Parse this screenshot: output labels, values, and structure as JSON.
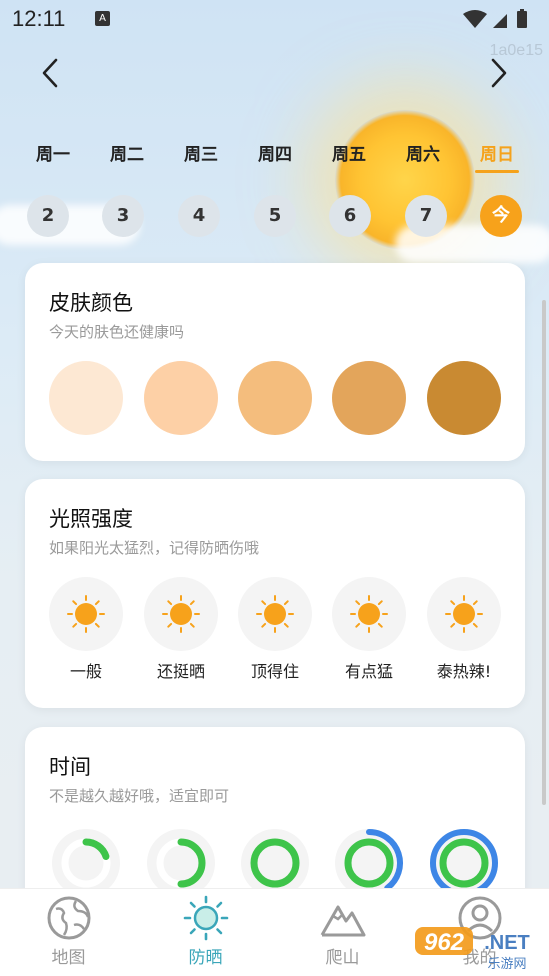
{
  "status_bar": {
    "time": "12:11",
    "app_badge": "A",
    "watermark": "1a0e15"
  },
  "nav": {
    "prev_icon": "chevron-left-icon",
    "next_icon": "chevron-right-icon"
  },
  "week": {
    "days": [
      {
        "label": "周一",
        "date": "2"
      },
      {
        "label": "周二",
        "date": "3"
      },
      {
        "label": "周三",
        "date": "4"
      },
      {
        "label": "周四",
        "date": "5"
      },
      {
        "label": "周五",
        "date": "6"
      },
      {
        "label": "周六",
        "date": "7"
      },
      {
        "label": "周日",
        "date": "今"
      }
    ],
    "active_index": 6,
    "accent_color": "#f5a21b"
  },
  "skin_card": {
    "title": "皮肤颜色",
    "subtitle": "今天的肤色还健康吗",
    "swatches": [
      "#fde8d3",
      "#fdd0a6",
      "#f4bd7d",
      "#e3a55b",
      "#c98a32"
    ]
  },
  "light_card": {
    "title": "光照强度",
    "subtitle": "如果阳光太猛烈，记得防晒伤哦",
    "levels": [
      {
        "label": "一般",
        "icon": "sun-icon"
      },
      {
        "label": "还挺晒",
        "icon": "sun-icon"
      },
      {
        "label": "顶得住",
        "icon": "sun-icon"
      },
      {
        "label": "有点猛",
        "icon": "sun-icon"
      },
      {
        "label": "泰热辣!",
        "icon": "sun-icon"
      }
    ],
    "sun_color": "#f7a21b"
  },
  "time_card": {
    "title": "时间",
    "subtitle": "不是越久越好哦，适宜即可",
    "levels": [
      {
        "green_fraction": 0.2,
        "blue_fraction": 0
      },
      {
        "green_fraction": 0.5,
        "blue_fraction": 0
      },
      {
        "green_fraction": 1.0,
        "blue_fraction": 0
      },
      {
        "green_fraction": 1.0,
        "blue_fraction": 0.4
      },
      {
        "green_fraction": 1.0,
        "blue_fraction": 1.0
      }
    ],
    "green": "#3ec44a",
    "blue": "#3d86e6"
  },
  "tabbar": {
    "tabs": [
      {
        "label": "地图",
        "icon": "globe-icon"
      },
      {
        "label": "防晒",
        "icon": "sun-tab-icon"
      },
      {
        "label": "爬山",
        "icon": "mountain-icon"
      },
      {
        "label": "我的",
        "icon": "user-icon"
      }
    ],
    "active_index": 1,
    "active_color": "#3aa6b9"
  },
  "logo": {
    "text": "962",
    "suffix": ".NET",
    "caption": "乐游网"
  }
}
